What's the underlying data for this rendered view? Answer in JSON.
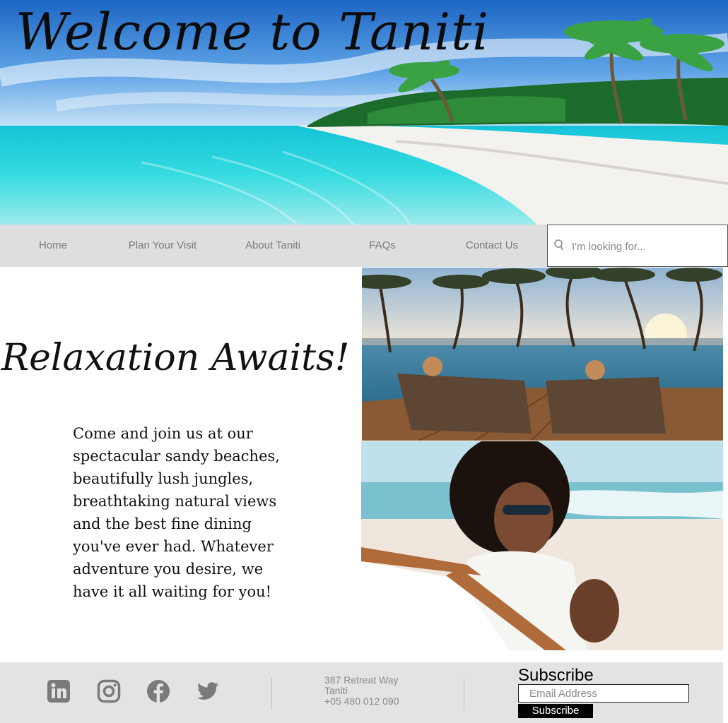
{
  "hero": {
    "title": "Welcome to Taniti"
  },
  "nav": {
    "items": [
      {
        "label": "Home"
      },
      {
        "label": "Plan Your Visit"
      },
      {
        "label": "About Taniti"
      },
      {
        "label": "FAQs"
      },
      {
        "label": "Contact Us"
      }
    ],
    "search": {
      "placeholder": "I'm looking for...",
      "icon": "search-icon"
    }
  },
  "main": {
    "title": "Relaxation Awaits!",
    "text": "Come and join us at our spectacular sandy beaches, beautifully lush jungles, breathtaking natural views and the best fine dining you've ever had. Whatever adventure you desire, we have it all waiting for you!"
  },
  "footer": {
    "social": [
      "linkedin-icon",
      "instagram-icon",
      "facebook-icon",
      "twitter-icon"
    ],
    "address": {
      "street": "387 Retreat Way",
      "city": "Taniti",
      "phone": "+05 480 012 090"
    },
    "subscribe": {
      "title": "Subscribe",
      "placeholder": "Email Address",
      "button": "Subscribe"
    }
  },
  "colors": {
    "nav_bg": "#dedede",
    "footer_bg": "#e3e3e3",
    "nav_text": "#7a7a7a",
    "icon_gray": "#7a7a7a",
    "button_bg": "#000000"
  }
}
